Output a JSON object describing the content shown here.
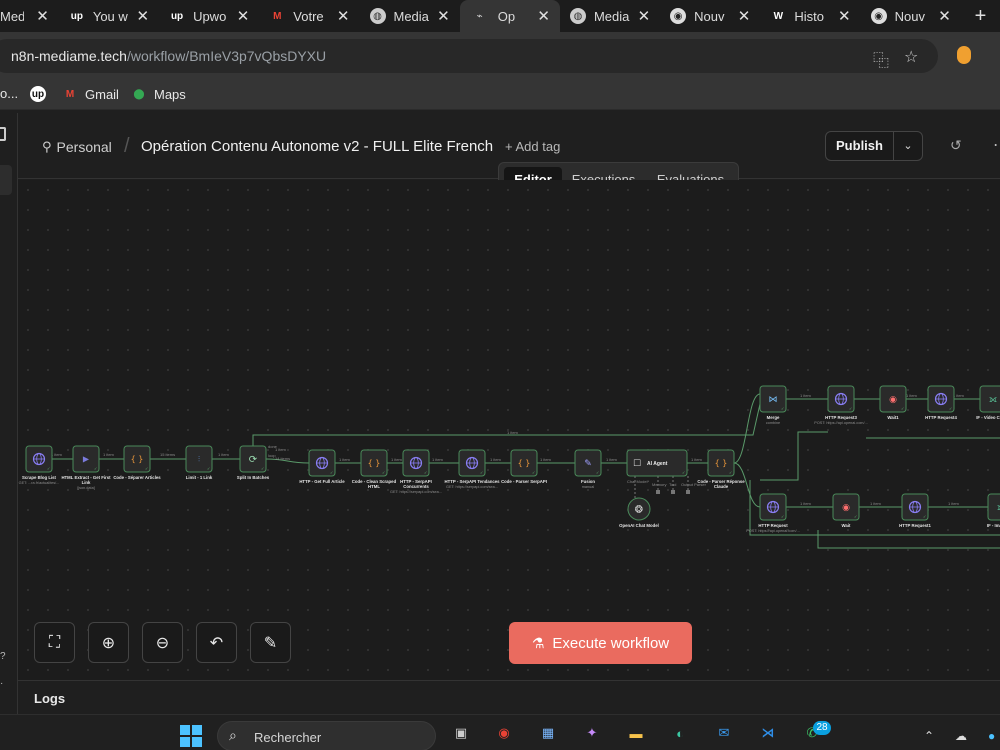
{
  "browser": {
    "tabs": [
      {
        "label": "Media",
        "icon": "globe-icon",
        "active": false
      },
      {
        "label": "You w",
        "icon": "upwork-icon",
        "active": false
      },
      {
        "label": "Upwo",
        "icon": "upwork-icon",
        "active": false
      },
      {
        "label": "Votre",
        "icon": "gmail-icon",
        "active": false
      },
      {
        "label": "Media",
        "icon": "globe-icon",
        "active": false
      },
      {
        "label": "Op",
        "icon": "n8n-icon",
        "active": true
      },
      {
        "label": "Media",
        "icon": "globe-icon",
        "active": false
      },
      {
        "label": "Nouv",
        "icon": "chrome-icon",
        "active": false
      },
      {
        "label": "Histo",
        "icon": "wix-icon",
        "active": false
      },
      {
        "label": "Nouv",
        "icon": "chrome-icon",
        "active": false
      }
    ],
    "url_host": "n8n-mediame.tech",
    "url_path": "/workflow/BmIeV3p7vQbsDYXU",
    "bookmarks": [
      {
        "label": "",
        "icon": "upwork-icon"
      },
      {
        "label": "Gmail",
        "icon": "gmail-icon"
      },
      {
        "label": "Maps",
        "icon": "maps-icon"
      }
    ],
    "bookmark_ellipsis": "o..."
  },
  "header": {
    "project": "Personal",
    "workflow_title": "Opération Contenu Autonome v2 - FULL Elite French",
    "add_tag": "+ Add tag",
    "publish": "Publish"
  },
  "view_tabs": [
    {
      "label": "Editor",
      "active": true
    },
    {
      "label": "Executions",
      "active": false
    },
    {
      "label": "Evaluations",
      "active": false
    }
  ],
  "workflow": {
    "nodes": [
      {
        "id": "scrape",
        "label": "Scrape Blog List",
        "sub": "GET: ...ra.fr/actualites/...",
        "icon": "globe"
      },
      {
        "id": "html",
        "label": "HTML Extract - Get First Link",
        "sub": "[json.data]",
        "icon": "code"
      },
      {
        "id": "sep",
        "label": "Code - Séparer Articles",
        "sub": "",
        "icon": "braces"
      },
      {
        "id": "limit",
        "label": "Limit - 1 Link",
        "sub": "",
        "icon": "limit"
      },
      {
        "id": "split",
        "label": "Split In Batches",
        "sub": "",
        "icon": "loop"
      },
      {
        "id": "getfull",
        "label": "HTTP - Get Full Article",
        "sub": "",
        "icon": "globe"
      },
      {
        "id": "clean",
        "label": "Code - Clean Scraped HTML",
        "sub": "",
        "icon": "braces"
      },
      {
        "id": "serp1",
        "label": "HTTP - SerpAPI Concurrents",
        "sub": "GET: https://serpapi.com/sea...",
        "icon": "globe"
      },
      {
        "id": "serp2",
        "label": "HTTP - SerpAPI Tendances",
        "sub": "GET: https://serpapi.com/sea...",
        "icon": "globe"
      },
      {
        "id": "parse",
        "label": "Code - Parser SerpAPI",
        "sub": "",
        "icon": "braces"
      },
      {
        "id": "fusion",
        "label": "Fusion",
        "sub": "manual",
        "icon": "pen"
      },
      {
        "id": "agent",
        "label": "AI Agent",
        "sub": "",
        "icon": "robot"
      },
      {
        "id": "openai",
        "label": "OpenAI Chat Model",
        "sub": "",
        "icon": "openai"
      },
      {
        "id": "claude",
        "label": "Code - Parser Réponse Claude",
        "sub": "",
        "icon": "braces"
      },
      {
        "id": "merge",
        "label": "Merge",
        "sub": "combine",
        "icon": "merge"
      },
      {
        "id": "http3",
        "label": "HTTP Request3",
        "sub": "POST: https://api.openai.com/...",
        "icon": "globe"
      },
      {
        "id": "wait1",
        "label": "Wait1",
        "sub": "",
        "icon": "pause"
      },
      {
        "id": "http4",
        "label": "HTTP Request4",
        "sub": "",
        "icon": "globe"
      },
      {
        "id": "ifvideo",
        "label": "IF - Video Com...",
        "sub": "",
        "icon": "if"
      },
      {
        "id": "http0",
        "label": "HTTP Request",
        "sub": "POST: https://api.openai.com/...",
        "icon": "globe"
      },
      {
        "id": "wait",
        "label": "Wait",
        "sub": "",
        "icon": "pause"
      },
      {
        "id": "http1",
        "label": "HTTP Request1",
        "sub": "",
        "icon": "globe"
      },
      {
        "id": "ifimage",
        "label": "IF - Image G...",
        "sub": "",
        "icon": "if"
      }
    ],
    "edge_labels": {
      "items": "1 item",
      "items14": "14 items",
      "items15": "15 items",
      "done": "done",
      "loop": "loop",
      "chat_model": "Chat Model*",
      "memory": "Memory",
      "tool": "Tool",
      "output_parser": "Output Parser"
    }
  },
  "canvas_controls": [
    {
      "name": "zoom-to-fit-button",
      "icon": "⛶"
    },
    {
      "name": "zoom-in-button",
      "icon": "⊕"
    },
    {
      "name": "zoom-out-button",
      "icon": "⊖"
    },
    {
      "name": "undo-button",
      "icon": "↶"
    },
    {
      "name": "tidy-up-button",
      "icon": "✎"
    }
  ],
  "execute_label": "Execute workflow",
  "logs_label": "Logs",
  "taskbar": {
    "search_placeholder": "Rechercher",
    "notif_badge": "28",
    "apps": [
      "task-view-icon",
      "chrome-icon",
      "store-icon",
      "copilot-icon",
      "file-explorer-icon",
      "edge-icon",
      "mail-icon",
      "vscode-icon",
      "whatsapp-icon"
    ]
  },
  "colors": {
    "accent": "#ea6b5f",
    "edge": "#5a9a6a",
    "node_border": "#4a8a5a",
    "globe": "#8a7ef5",
    "braces": "#f09a3a"
  }
}
